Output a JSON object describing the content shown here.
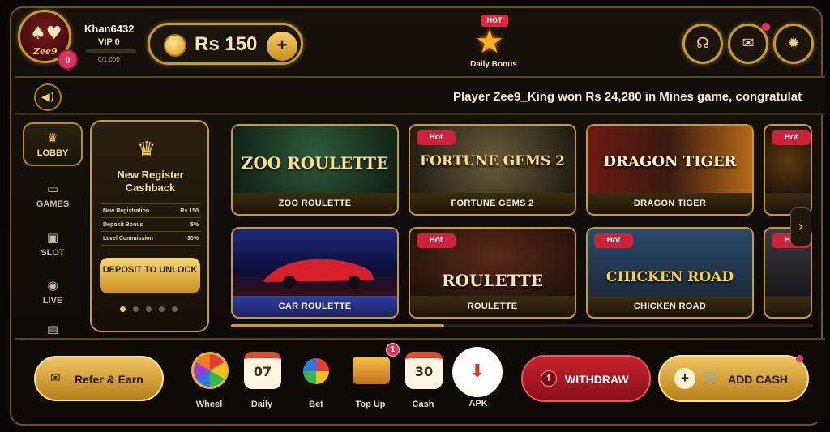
{
  "user": {
    "name": "Khan6432",
    "vip": "VIP 0",
    "xp": "0/1,000",
    "avatar_badge": "0",
    "avatar_brand": "Zee9"
  },
  "wallet": {
    "balance": "Rs 150",
    "add_label": "+"
  },
  "daily_bonus": {
    "tag": "HOT",
    "label": "Daily Bonus"
  },
  "ticker": {
    "message": "Player Zee9_King won Rs 24,280 in Mines game, congratulat"
  },
  "sidebar": {
    "items": [
      {
        "label": "LOBBY"
      },
      {
        "label": "GAMES"
      },
      {
        "label": "SLOT"
      },
      {
        "label": "LIVE"
      }
    ]
  },
  "promo": {
    "title": "New Register Cashback",
    "rows": [
      {
        "name": "New Registration",
        "value": "Rs 150"
      },
      {
        "name": "Deposit Bonus",
        "value": "5%"
      },
      {
        "name": "Level Commission",
        "value": "30%"
      }
    ],
    "button": "DEPOSIT TO UNLOCK",
    "page_count": 5,
    "active_page": 1
  },
  "games": [
    {
      "label": "ZOO ROULETTE",
      "art": "ZOO ROULETTE",
      "hot": ""
    },
    {
      "label": "FORTUNE GEMS 2",
      "art": "FORTUNE GEMS 2",
      "hot": "Hot"
    },
    {
      "label": "DRAGON TIGER",
      "art": "DRAGON TIGER",
      "hot": ""
    },
    {
      "label": "",
      "art": "",
      "hot": "Hot"
    },
    {
      "label": "CAR ROULETTE",
      "art": "",
      "hot": ""
    },
    {
      "label": "ROULETTE",
      "art": "ROULETTE",
      "hot": "Hot"
    },
    {
      "label": "CHICKEN ROAD",
      "art": "CHICKEN ROAD",
      "hot": "Hot"
    },
    {
      "label": "",
      "art": "",
      "hot": "Hot"
    }
  ],
  "bottom": {
    "refer": "Refer & Earn",
    "tools": [
      {
        "label": "Wheel",
        "icon": ""
      },
      {
        "label": "Daily",
        "icon": "07"
      },
      {
        "label": "Bet",
        "icon": ""
      },
      {
        "label": "Top Up",
        "icon": ""
      },
      {
        "label": "Cash",
        "icon": "30"
      }
    ],
    "topup_badge": "1",
    "apk": "APK",
    "withdraw": "WITHDRAW",
    "addcash": "ADD CASH"
  },
  "colors": {
    "gold": "#c79a2c",
    "accent_red": "#c9232f",
    "background": "#0a0804"
  }
}
